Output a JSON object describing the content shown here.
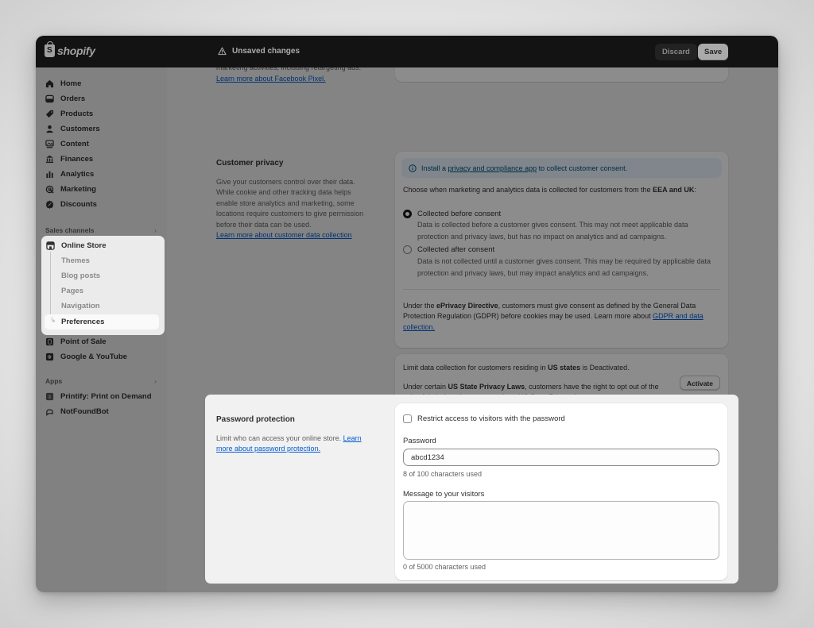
{
  "topbar": {
    "brand": "shopify",
    "status": "Unsaved changes",
    "discard_label": "Discard",
    "save_label": "Save"
  },
  "sidebar": {
    "items": [
      {
        "label": "Home",
        "icon": "home-icon"
      },
      {
        "label": "Orders",
        "icon": "inbox-icon"
      },
      {
        "label": "Products",
        "icon": "tag-icon"
      },
      {
        "label": "Customers",
        "icon": "person-icon"
      },
      {
        "label": "Content",
        "icon": "image-icon"
      },
      {
        "label": "Finances",
        "icon": "bank-icon"
      },
      {
        "label": "Analytics",
        "icon": "bar-chart-icon"
      },
      {
        "label": "Marketing",
        "icon": "target-icon"
      },
      {
        "label": "Discounts",
        "icon": "discount-icon"
      }
    ],
    "sales_channels_label": "Sales channels",
    "online_store": {
      "label": "Online Store",
      "sub_items": [
        "Themes",
        "Blog posts",
        "Pages",
        "Navigation",
        "Preferences"
      ],
      "active": "Preferences"
    },
    "channels": [
      {
        "label": "Point of Sale",
        "icon": "pos-icon"
      },
      {
        "label": "Google & YouTube",
        "icon": "google-icon"
      }
    ],
    "apps_label": "Apps",
    "apps": [
      {
        "label": "Printify: Print on Demand",
        "icon": "printify-icon"
      },
      {
        "label": "NotFoundBot",
        "icon": "bot-icon"
      }
    ]
  },
  "facebook": {
    "cut_text": "marketing activities, including retargeting ads.",
    "link": "Learn more about Facebook Pixel."
  },
  "customer_privacy": {
    "title": "Customer privacy",
    "description": "Give your customers control over their data. While cookie and other tracking data helps enable store analytics and marketing, some locations require customers to give permission before their data can be used.",
    "link": "Learn more about customer data collection",
    "banner_prefix": "Install a ",
    "banner_link": "privacy and compliance app",
    "banner_suffix": " to collect customer consent.",
    "choose_prefix": "Choose when marketing and analytics data is collected for customers from the ",
    "choose_bold": "EEA and UK",
    "choose_suffix": ":",
    "options": [
      {
        "label": "Collected before consent",
        "description": "Data is collected before a customer gives consent. This may not meet applicable data protection and privacy laws, but has no impact on analytics and ad campaigns.",
        "checked": true
      },
      {
        "label": "Collected after consent",
        "description": "Data is not collected until a customer gives consent. This may be required by applicable data protection and privacy laws, but may impact analytics and ad campaigns.",
        "checked": false
      }
    ],
    "eprivacy_prefix": "Under the ",
    "eprivacy_bold": "ePrivacy Directive",
    "eprivacy_text": ", customers must give consent as defined by the General Data Protection Regulation (GDPR) before cookies may be used. Learn more about ",
    "eprivacy_link": "GDPR and data collection."
  },
  "us_states": {
    "line1_prefix": "Limit data collection for customers residing in ",
    "line1_bold": "US states",
    "line1_suffix": " is Deactivated.",
    "line2_prefix": "Under certain ",
    "line2_bold": "US State Privacy Laws",
    "line2_text": ", customers have the right to opt out of the sale of their data. Learn more about ",
    "line2_link": "US State Privacy Laws",
    "line2_end": ".",
    "activate_label": "Activate"
  },
  "password_protection": {
    "title": "Password protection",
    "description": "Limit who can access your online store. ",
    "link": "Learn more about password protection.",
    "restrict_label": "Restrict access to visitors with the password",
    "restrict_checked": false,
    "password_label": "Password",
    "password_value": "abcd1234",
    "password_help": "8 of 100 characters used",
    "message_label": "Message to your visitors",
    "message_value": "",
    "message_help": "0 of 5000 characters used"
  }
}
